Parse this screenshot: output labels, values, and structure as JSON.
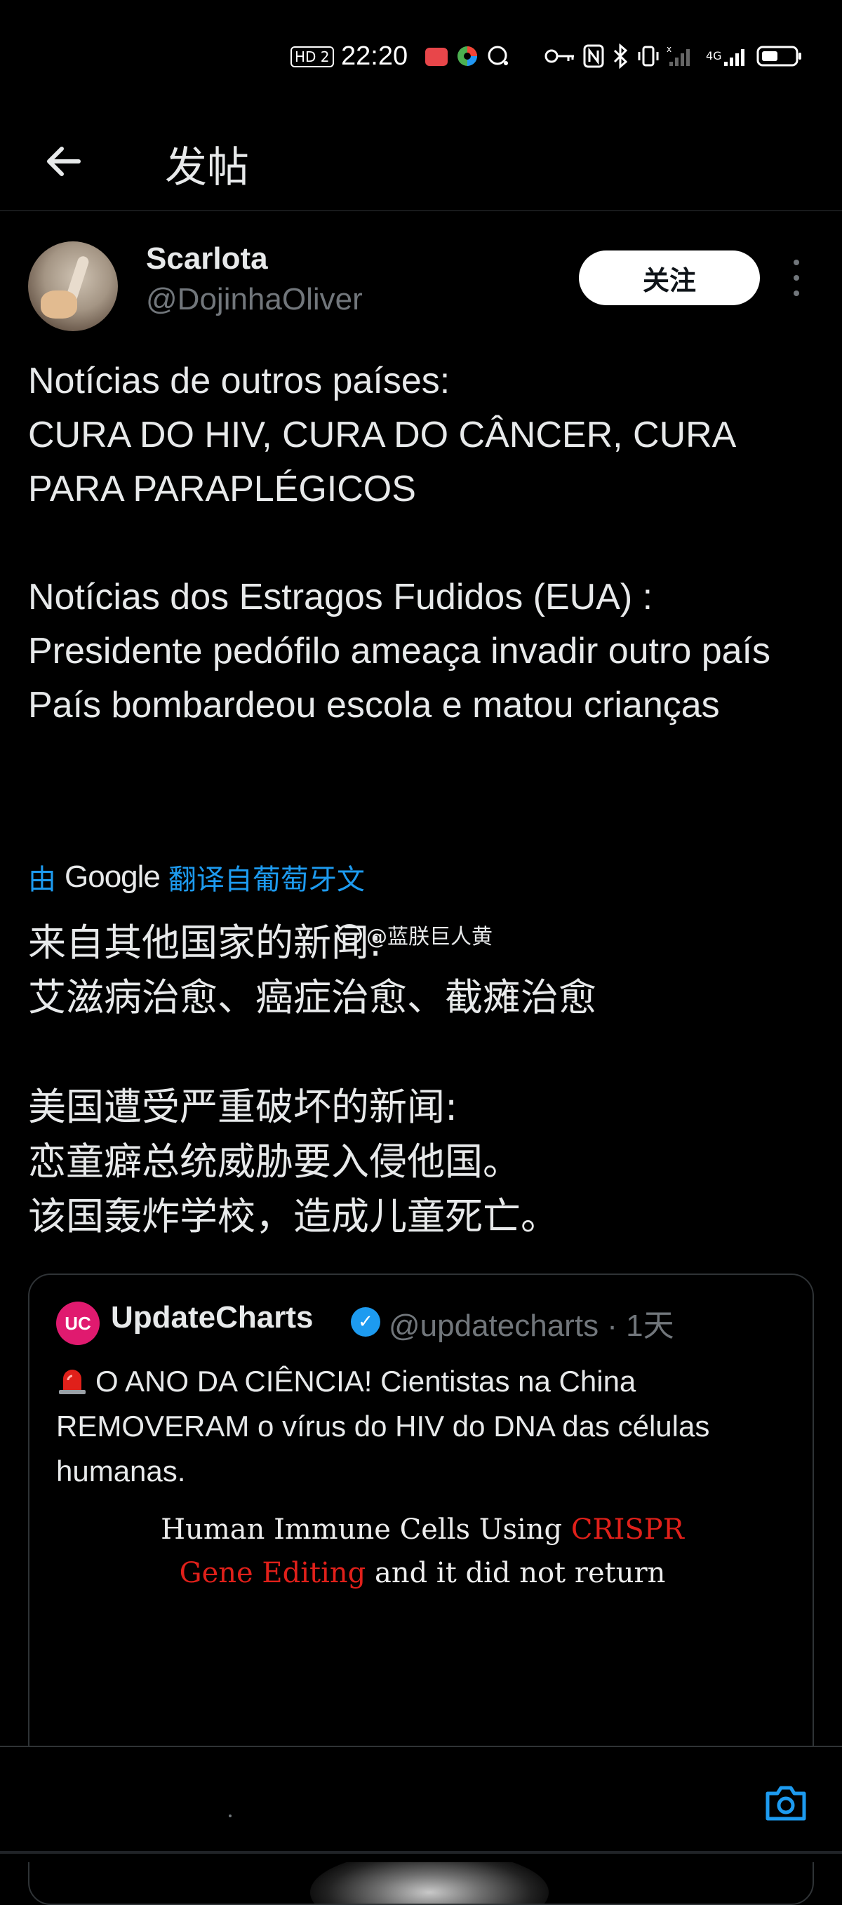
{
  "status_bar": {
    "hd_label": "HD 2",
    "time": "22:20",
    "network_label": "4G"
  },
  "header": {
    "title": "发帖"
  },
  "author": {
    "name": "Scarlota",
    "handle": "@DojinhaOliver",
    "follow_label": "关注"
  },
  "post": {
    "original_text": "Notícias de outros países:\nCURA DO HIV, CURA DO CÂNCER, CURA PARA PARAPLÉGICOS\n\nNotícias dos Estragos Fudidos (EUA) :\nPresidente pedófilo ameaça invadir outro país\nPaís bombardeou escola e matou crianças",
    "translate_prefix": "由",
    "translate_brand": "Google",
    "translate_suffix": "翻译自葡萄牙文",
    "translated_text": "来自其他国家的新闻:\n艾滋病治愈、癌症治愈、截瘫治愈\n\n美国遭受严重破坏的新闻:\n恋童癖总统威胁要入侵他国。\n该国轰炸学校，造成儿童死亡。",
    "watermark": "@蓝朕巨人黄"
  },
  "quoted": {
    "logo_text": "UC",
    "name": "UpdateCharts",
    "handle_time": "@updatecharts · 1天",
    "text": "O ANO DA CIÊNCIA! Cientistas na China REMOVERAM o vírus do HIV do DNA das células humanas.",
    "image_line1_a": "Human Immune Cells Using ",
    "image_line1_b": "CRISPR",
    "image_line2_a": "Gene  Editing",
    "image_line2_b": " and it did not return"
  },
  "colors": {
    "background": "#000000",
    "text": "#e7e9ea",
    "muted": "#71767b",
    "accent": "#1d9bf0",
    "brand_pink": "#e01a6f"
  }
}
